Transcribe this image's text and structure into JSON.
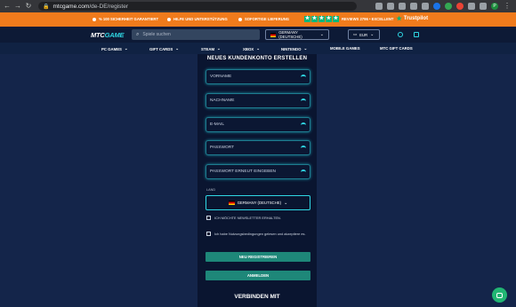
{
  "browser": {
    "url_host": "mtcgame.com",
    "url_path": "/de-DE/register"
  },
  "banner": {
    "item1": "% 100 SICHERHEIT GARANTIERT",
    "item2": "HILFE UND UNTERSTÜTZUNG",
    "item3": "SOFORTIGE LIEFERUNG",
    "review_text": "REVIEWS 2796 • EXCELLENT",
    "trustpilot": "Trustpilot"
  },
  "header": {
    "logo_mtc": "MTC",
    "logo_game": "GAME",
    "search_placeholder": "Spiele suchen",
    "country": "GERMANY (DEUTSCHE)",
    "currency": "EUR"
  },
  "nav": [
    {
      "label": "PC GAMES",
      "chevron": "⌄"
    },
    {
      "label": "GIFT CARDS",
      "chevron": "⌄"
    },
    {
      "label": "STEAM",
      "chevron": "⌄"
    },
    {
      "label": "XBOX",
      "chevron": "⌄"
    },
    {
      "label": "NINTENDO",
      "chevron": "⌄"
    },
    {
      "label": "MOBILE GAMES",
      "chevron": ""
    },
    {
      "label": "MTC GIFT CARDS",
      "chevron": ""
    }
  ],
  "form": {
    "title": "NEUES KUNDENKONTO ERSTELLEN",
    "fields": [
      {
        "placeholder": "VORNAME"
      },
      {
        "placeholder": "NACHNAME"
      },
      {
        "placeholder": "E-MAIL"
      },
      {
        "placeholder": "PASSWORT"
      },
      {
        "placeholder": "PASSWORT ERNEUT EINGEBEN"
      }
    ],
    "land_label": "LAND",
    "land_value": "GERMANY (DEUTSCHE)",
    "newsletter": "ICH MÖCHTE NEWSLETTER ERHALTEN.",
    "terms": "Ich habe Nutzungsbedingungen gelesen und akzeptiere es.",
    "register_button": "NEU REGISTRIEREN",
    "login_button": "ANMELDEN",
    "connect_title": "VERBINDEN MIT"
  },
  "colors": {
    "banner": "#f07b1c",
    "accent": "#2fd7e4",
    "button": "#1e8779",
    "background": "#14254a"
  }
}
